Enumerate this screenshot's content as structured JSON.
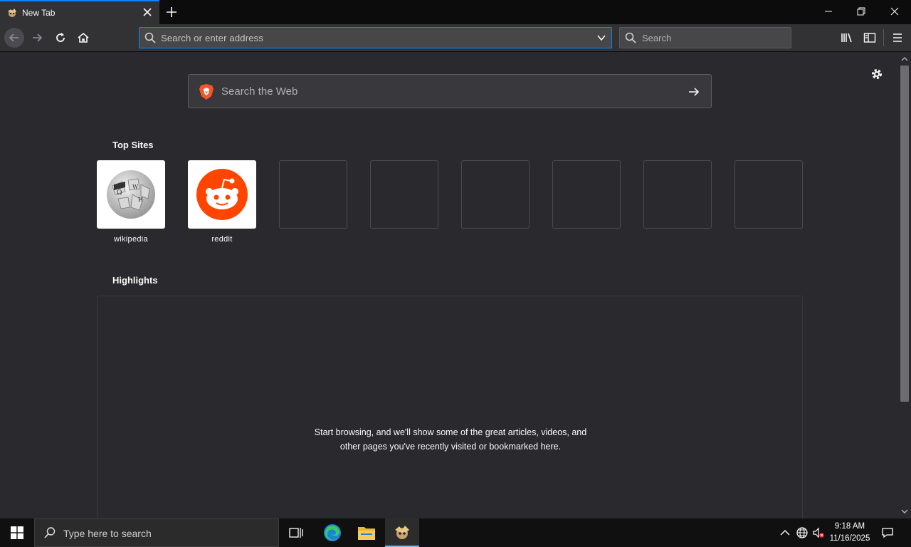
{
  "browser": {
    "tab": {
      "title": "New Tab"
    },
    "urlbar": {
      "placeholder": "Search or enter address"
    },
    "searchbar": {
      "placeholder": "Search"
    }
  },
  "newtab": {
    "websearch_placeholder": "Search the Web",
    "top_sites_title": "Top Sites",
    "top_sites": [
      {
        "label": "wikipedia"
      },
      {
        "label": "reddit"
      },
      {
        "label": ""
      },
      {
        "label": ""
      },
      {
        "label": ""
      },
      {
        "label": ""
      },
      {
        "label": ""
      },
      {
        "label": ""
      }
    ],
    "highlights_title": "Highlights",
    "highlights_empty_message": "Start browsing, and we'll show some of the great articles, videos, and other pages you've recently visited or bookmarked here."
  },
  "taskbar": {
    "search_placeholder": "Type here to search",
    "time": "9:18 AM",
    "date": "11/16/2025"
  },
  "colors": {
    "accent": "#0a84ff",
    "content_bg": "#2a2a2e",
    "toolbar_bg": "#323234",
    "reddit_orange": "#ff4500"
  }
}
